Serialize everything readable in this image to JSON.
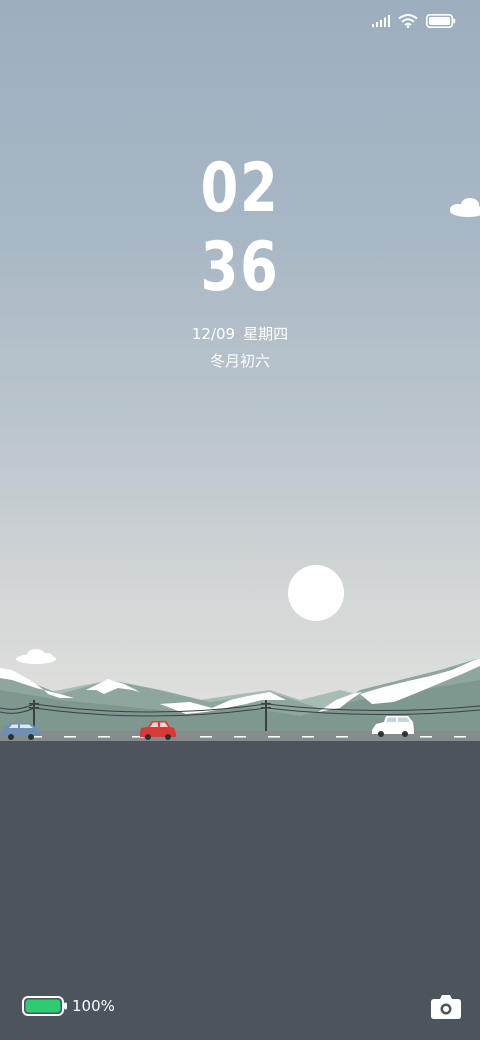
{
  "status_bar": {
    "icons": [
      "signal-icon",
      "wifi-icon",
      "battery-icon"
    ]
  },
  "clock": {
    "hours": "02",
    "minutes": "36"
  },
  "date": {
    "date": "12/09",
    "weekday": "星期四",
    "lunar": "冬月初六"
  },
  "bottom_bar": {
    "battery_percent": "100%",
    "battery_color": "#2ecc71",
    "camera_icon": "camera-icon"
  },
  "colors": {
    "sky_top": "#9daebf",
    "sky_bottom": "#dfe0dd",
    "ground": "#4c555e",
    "mountain": "#8fa79f",
    "car_red": "#d93a37",
    "car_blue": "#6f8fb3",
    "car_white": "#ffffff"
  }
}
